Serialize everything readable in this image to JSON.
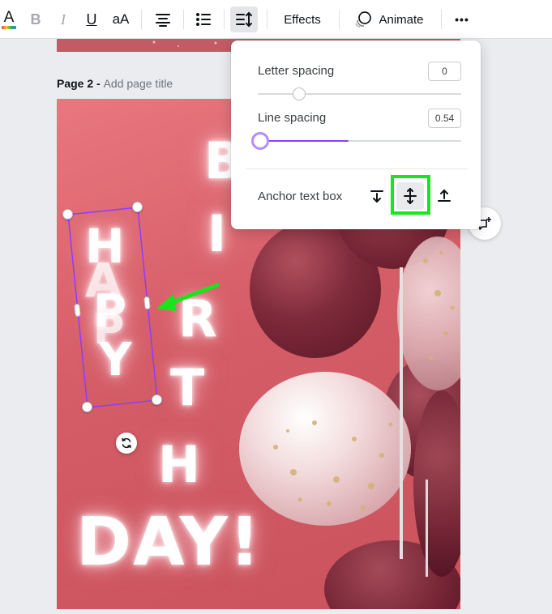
{
  "toolbar": {
    "text_color_letter": "A",
    "bold_letter": "B",
    "italic_letter": "I",
    "underline_letter": "U",
    "case_label": "aA",
    "effects_label": "Effects",
    "animate_label": "Animate",
    "more_label": "•••",
    "rainbow_colors": [
      "#e8453c",
      "#f7c52b",
      "#29b34a",
      "#2f80ed"
    ]
  },
  "page": {
    "number_label": "Page 2 - ",
    "title_placeholder": "Add page title"
  },
  "design": {
    "words": {
      "happy_stack": [
        "H",
        "A",
        "P",
        "P",
        "Y"
      ],
      "birthday_column": [
        "B",
        "I",
        "R",
        "T",
        "H"
      ],
      "day": "DAY!"
    },
    "background_color": "#d45d67"
  },
  "spacing_panel": {
    "letter_spacing": {
      "label": "Letter spacing",
      "value": "0"
    },
    "line_spacing": {
      "label": "Line spacing",
      "value": "0.54"
    },
    "anchor": {
      "label": "Anchor text box",
      "options": [
        "top",
        "middle",
        "bottom"
      ],
      "selected": "middle"
    },
    "accent_color": "#8b3dff"
  },
  "annotations": {
    "highlight_color": "#18e51a"
  }
}
